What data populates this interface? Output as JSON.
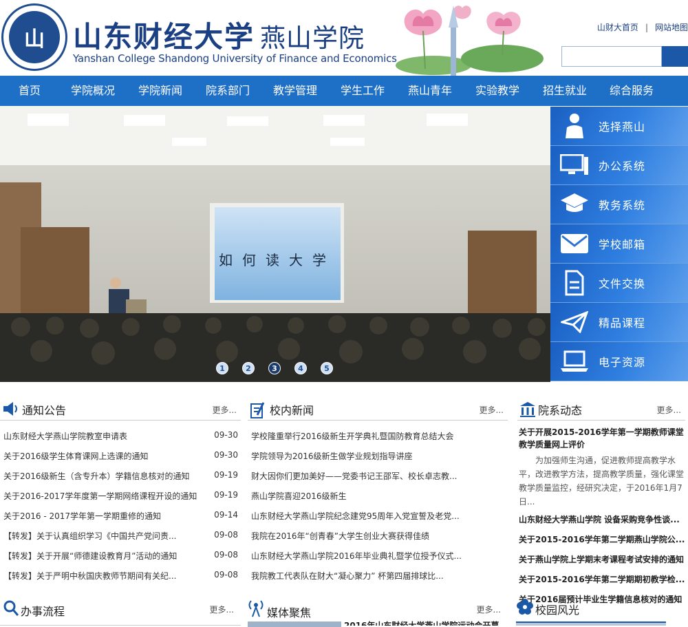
{
  "header": {
    "seal_text": "山",
    "logo_title": "山东财经大学",
    "logo_sub": "燕山学院",
    "logo_en": "Yanshan College Shandong University of Finance and Economics",
    "top_links": [
      "山财大首页",
      "网站地图"
    ],
    "top_sep": "|",
    "search_placeholder": ""
  },
  "nav": {
    "items": [
      "首页",
      "学院概况",
      "学院新闻",
      "院系部门",
      "教学管理",
      "学生工作",
      "燕山青年",
      "实验教学",
      "招生就业",
      "综合服务"
    ]
  },
  "banner": {
    "screen_text": "如何读大学",
    "dots": [
      "1",
      "2",
      "3",
      "4",
      "5"
    ],
    "active_dot": 3
  },
  "side_links": [
    {
      "label": "选择燕山",
      "icon": "student-icon"
    },
    {
      "label": "办公系统",
      "icon": "monitor-icon"
    },
    {
      "label": "教务系统",
      "icon": "graduation-cap-icon"
    },
    {
      "label": "学校邮箱",
      "icon": "mail-icon"
    },
    {
      "label": "文件交换",
      "icon": "file-exchange-icon"
    },
    {
      "label": "精品课程",
      "icon": "paper-plane-icon"
    },
    {
      "label": "电子资源",
      "icon": "laptop-icon"
    }
  ],
  "notices": {
    "title": "通知公告",
    "more": "更多...",
    "items": [
      {
        "text": "山东财经大学燕山学院教室申请表",
        "date": "09-30"
      },
      {
        "text": "关于2016级学生体育课网上选课的通知",
        "date": "09-30"
      },
      {
        "text": "关于2016级新生（含专升本）学籍信息核对的通知",
        "date": "09-19"
      },
      {
        "text": "关于2016-2017学年度第一学期网络课程开设的通知",
        "date": "09-19"
      },
      {
        "text": "关于2016 - 2017学年第一学期重修的通知",
        "date": "09-14"
      },
      {
        "text": "【转发】关于认真组织学习《中国共产党问责...",
        "date": "09-08"
      },
      {
        "text": "【转发】关于开展“师德建设教育月”活动的通知",
        "date": "09-08"
      },
      {
        "text": "【转发】关于严明中秋国庆教师节期间有关纪...",
        "date": "09-08"
      }
    ]
  },
  "news": {
    "title": "校内新闻",
    "more": "更多...",
    "items": [
      "学校隆重举行2016级新生开学典礼暨国防教育总结大会",
      "学院领导为2016级新生做学业规划指导讲座",
      "财大因你们更加美好——党委书记王邵军、校长卓志教...",
      "燕山学院喜迎2016级新生",
      "山东财经大学燕山学院纪念建党95周年入党宣誓及老党...",
      "我院在2016年“创青春”大学生创业大赛获得佳绩",
      "山东财经大学燕山学院2016年毕业典礼暨学位授予仪式...",
      "我院教工代表队在财大“凝心聚力” 杯第四届排球比..."
    ]
  },
  "dept": {
    "title": "院系动态",
    "more": "更多...",
    "feature_title": "关于开展2015-2016学年第一学期教师课堂教学质量网上评价",
    "feature_body": "为加强师生沟通，促进教师提高教学水平，改进教学方法，提高教学质量，强化课堂教学质量监控，经研究决定，于2016年1月7日...",
    "items": [
      "山东财经大学燕山学院 设备采购竞争性谈...",
      "关于2015-2016学年第二学期燕山学院公...",
      "关于燕山学院上学期末考课程考试安排的通知",
      "关于2015-2016学年第二学期期初教学检...",
      "关于2016届预计毕业生学籍信息核对的通知"
    ]
  },
  "bottom": {
    "procedures_title": "办事流程",
    "procedures_more": "更多...",
    "media_title": "媒体聚焦",
    "media_more": "更多...",
    "media_first": "2016年山东财经大学燕山学院运动会开幕",
    "campus_title": "校园风光"
  },
  "colors": {
    "brand_blue": "#1e6fc6",
    "title_blue": "#1b3f83"
  }
}
